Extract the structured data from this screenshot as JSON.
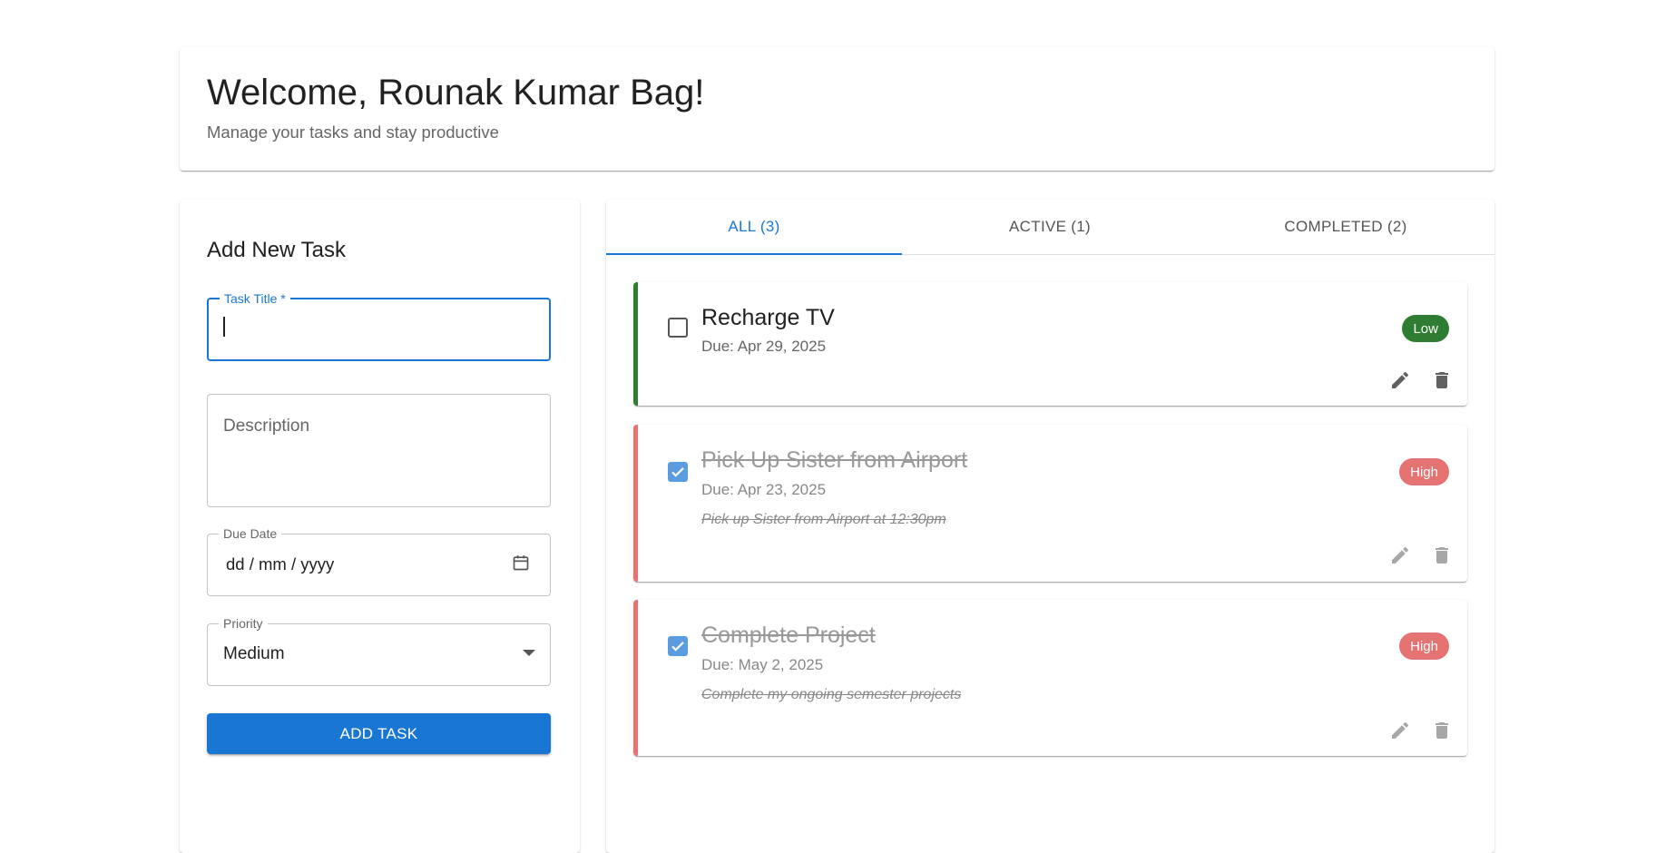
{
  "header": {
    "title": "Welcome, Rounak Kumar Bag!",
    "subtitle": "Manage your tasks and stay productive"
  },
  "form": {
    "heading": "Add New Task",
    "title_label": "Task Title *",
    "title_value": "",
    "description_placeholder": "Description",
    "due_date_label": "Due Date",
    "due_date_placeholder": "dd / mm / yyyy",
    "priority_label": "Priority",
    "priority_value": "Medium",
    "submit_label": "ADD TASK"
  },
  "tabs": [
    {
      "label": "ALL (3)",
      "active": true
    },
    {
      "label": "ACTIVE (1)",
      "active": false
    },
    {
      "label": "COMPLETED (2)",
      "active": false
    }
  ],
  "tasks": [
    {
      "title": "Recharge TV",
      "due": "Due: Apr 29, 2025",
      "description": "",
      "priority": "Low",
      "completed": false,
      "priority_color": "#2e7d32"
    },
    {
      "title": "Pick Up Sister from Airport",
      "due": "Due: Apr 23, 2025",
      "description": "Pick up Sister from Airport at 12:30pm",
      "priority": "High",
      "completed": true,
      "priority_color": "#e57373"
    },
    {
      "title": "Complete Project",
      "due": "Due: May 2, 2025",
      "description": "Complete my ongoing semester projects",
      "priority": "High",
      "completed": true,
      "priority_color": "#e57373"
    }
  ],
  "colors": {
    "accent": "#1976d2",
    "low_priority": "#2e7d32",
    "high_priority": "#e57373",
    "checkbox_checked": "#5b9be0"
  },
  "icons": {
    "edit": "edit-icon",
    "delete": "delete-icon",
    "calendar": "calendar-icon",
    "dropdown": "arrow-drop-down-icon"
  }
}
